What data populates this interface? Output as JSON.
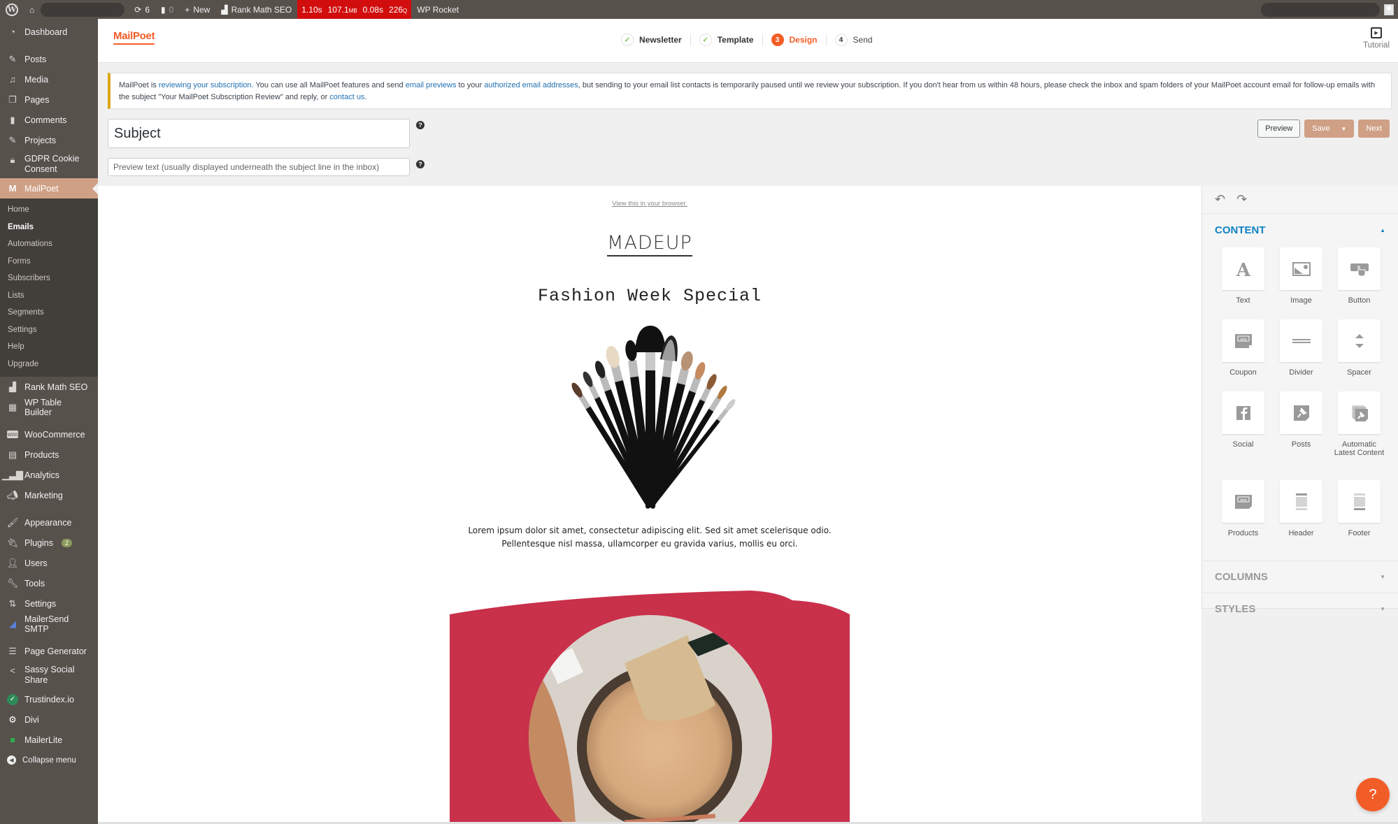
{
  "adminbar": {
    "updates_count": "6",
    "comments_count": "0",
    "new_label": "New",
    "rankmath_label": "Rank Math SEO",
    "perf": {
      "time": "1.10s",
      "memory": "107.1",
      "memory_unit": "MB",
      "query_time": "0.08s",
      "queries": "226",
      "queries_unit": "Q"
    },
    "wprocket_label": "WP Rocket"
  },
  "sidebar": {
    "items": [
      {
        "label": "Dashboard",
        "icon": "dashboard-icon"
      },
      {
        "label": "Posts",
        "icon": "pin-icon"
      },
      {
        "label": "Media",
        "icon": "media-icon"
      },
      {
        "label": "Pages",
        "icon": "pages-icon"
      },
      {
        "label": "Comments",
        "icon": "comment-icon"
      },
      {
        "label": "Projects",
        "icon": "pin-icon"
      },
      {
        "label": "GDPR Cookie Consent",
        "icon": "lock-icon"
      },
      {
        "label": "MailPoet",
        "icon": "mailpoet-icon"
      }
    ],
    "mailpoet_sub": [
      "Home",
      "Emails",
      "Automations",
      "Forms",
      "Subscribers",
      "Lists",
      "Segments",
      "Settings",
      "Help",
      "Upgrade"
    ],
    "mailpoet_current": "Emails",
    "items2": [
      {
        "label": "Rank Math SEO",
        "icon": "rankmath-icon"
      },
      {
        "label": "WP Table Builder",
        "icon": "table-icon"
      },
      {
        "label": "WooCommerce",
        "icon": "woo-icon"
      },
      {
        "label": "Products",
        "icon": "archive-icon"
      },
      {
        "label": "Analytics",
        "icon": "bar-chart-icon"
      },
      {
        "label": "Marketing",
        "icon": "megaphone-icon"
      },
      {
        "label": "Appearance",
        "icon": "brush-icon"
      },
      {
        "label": "Plugins",
        "icon": "plugin-icon",
        "badge": "2"
      },
      {
        "label": "Users",
        "icon": "user-icon"
      },
      {
        "label": "Tools",
        "icon": "wrench-icon"
      },
      {
        "label": "Settings",
        "icon": "settings-icon"
      },
      {
        "label": "MailerSend SMTP",
        "icon": "mailersend-icon"
      },
      {
        "label": "Page Generator",
        "icon": "page-generator-icon"
      },
      {
        "label": "Sassy Social Share",
        "icon": "share-icon"
      },
      {
        "label": "Trustindex.io",
        "icon": "check-circle-icon"
      },
      {
        "label": "Divi",
        "icon": "gear-icon"
      },
      {
        "label": "MailerLite",
        "icon": "chat-icon"
      },
      {
        "label": "Collapse menu",
        "icon": "collapse-icon"
      }
    ]
  },
  "header": {
    "logo": "MailPoet",
    "steps": [
      {
        "num": "✓",
        "label": "Newsletter",
        "state": "done"
      },
      {
        "num": "✓",
        "label": "Template",
        "state": "done"
      },
      {
        "num": "3",
        "label": "Design",
        "state": "current"
      },
      {
        "num": "4",
        "label": "Send",
        "state": "todo"
      }
    ],
    "tutorial_label": "Tutorial"
  },
  "notice": {
    "t1": "MailPoet is ",
    "link1": "reviewing your subscription.",
    "t2": " You can use all MailPoet features and send ",
    "link2": "email previews",
    "t3": " to your ",
    "link3": "authorized email addresses",
    "t4": ", but sending to your email list contacts is temporarily paused until we review your subscription. If you don't hear from us within 48 hours, please check the inbox and spam folders of your MailPoet account email for follow-up emails with the subject \"Your MailPoet Subscription Review\" and reply, or ",
    "link4": "contact us",
    "t5": "."
  },
  "form": {
    "subject_value": "Subject",
    "preview_placeholder": "Preview text (usually displayed underneath the subject line in the inbox)",
    "preview_value": ""
  },
  "actions": {
    "preview": "Preview",
    "save": "Save",
    "next": "Next"
  },
  "email": {
    "view_in_browser": "View this in your browser.",
    "brand": "MADEUP",
    "headline": "Fashion Week Special",
    "body_line1": "Lorem ipsum dolor sit amet, consectetur adipiscing elit. Sed sit amet scelerisque odio.",
    "body_line2": "Pellentesque nisl massa, ullamcorper eu gravida varius, mollis eu orci.",
    "accent_color": "#c9304a"
  },
  "panel": {
    "content_label": "CONTENT",
    "columns_label": "COLUMNS",
    "styles_label": "STYLES",
    "blocks": [
      "Text",
      "Image",
      "Button",
      "Coupon",
      "Divider",
      "Spacer",
      "Social",
      "Posts",
      "Automatic Latest Content",
      "Products",
      "Header",
      "Footer"
    ]
  },
  "colors": {
    "mailpoet_orange": "#f25d27",
    "wp_sidebar": "#57514c",
    "active_menu": "#cfa086",
    "content_blue": "#0e82c4"
  },
  "help_fab": "?"
}
